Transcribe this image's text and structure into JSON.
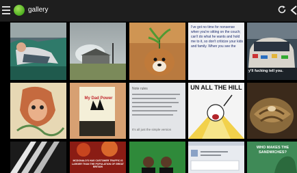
{
  "app": {
    "title": "gallery",
    "icons": {
      "menu": "menu-icon",
      "app": "app-icon",
      "refresh": "refresh-icon",
      "back": "back-icon"
    },
    "colors": {
      "actionbar": "#1e1e1e",
      "background": "#000000",
      "app_icon": "#4caf1f",
      "title_text": "#ffffff"
    }
  },
  "gallery": {
    "row1": {
      "handwritten_note": "I've got no time for nonsense when you're sitting on the couch; can't do what he wants and hold me to it, so don't criticize your kids and family. When you see the",
      "car_caption": "y'll fucking tell you."
    },
    "row2": {
      "book_title": "My Dad Power",
      "notes_heading": "Note rules",
      "notes_footer": "It's all just the simple version",
      "meme_text": "UN ALL THE HILL"
    },
    "row3": {
      "quote_text": "MCDONALD'S HAS CUSTOMER TRAFFIC IS LARGER THAN THE POPULATION OF GREAT BRITAIN",
      "raptor_text": "WHO MAKES THE SANDWICHES?"
    }
  }
}
